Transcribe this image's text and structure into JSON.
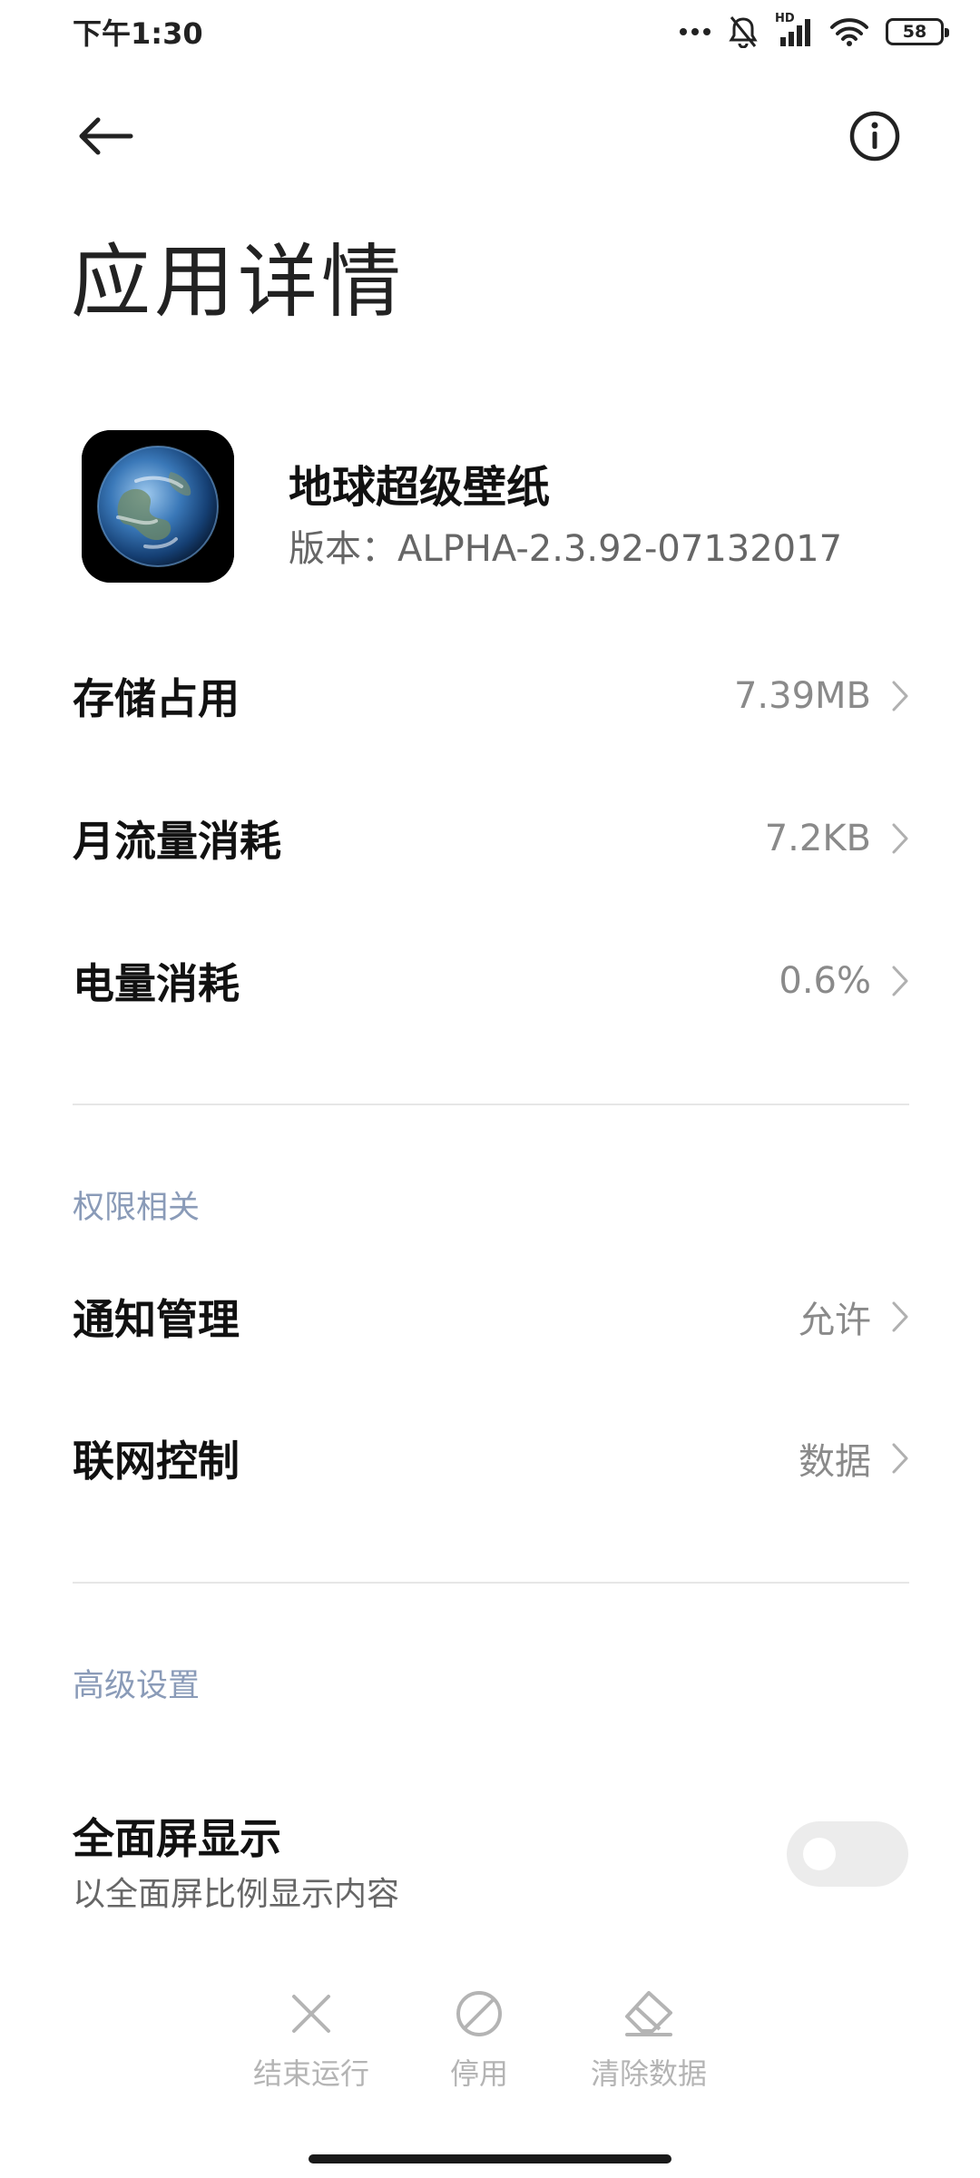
{
  "status_bar": {
    "time": "下午1:30",
    "battery": "58",
    "hd_label": "HD"
  },
  "header": {
    "title": "应用详情"
  },
  "app": {
    "name": "地球超级壁纸",
    "version": "版本：ALPHA-2.3.92-07132017"
  },
  "usage": [
    {
      "label": "存储占用",
      "value": "7.39MB"
    },
    {
      "label": "月流量消耗",
      "value": "7.2KB"
    },
    {
      "label": "电量消耗",
      "value": "0.6%"
    }
  ],
  "permissions": {
    "header": "权限相关",
    "items": [
      {
        "label": "通知管理",
        "value": "允许"
      },
      {
        "label": "联网控制",
        "value": "数据"
      }
    ]
  },
  "advanced": {
    "header": "高级设置",
    "fullscreen": {
      "label": "全面屏显示",
      "sublabel": "以全面屏比例显示内容",
      "enabled": false
    }
  },
  "actions": [
    {
      "label": "结束运行",
      "icon": "close-icon"
    },
    {
      "label": "停用",
      "icon": "disable-icon"
    },
    {
      "label": "清除数据",
      "icon": "eraser-icon"
    }
  ],
  "colors": {
    "section_header": "#8a9bb8",
    "value_text": "#8a8a8a",
    "action_text": "#b4b4b4",
    "toggle_off": "#ececec"
  }
}
